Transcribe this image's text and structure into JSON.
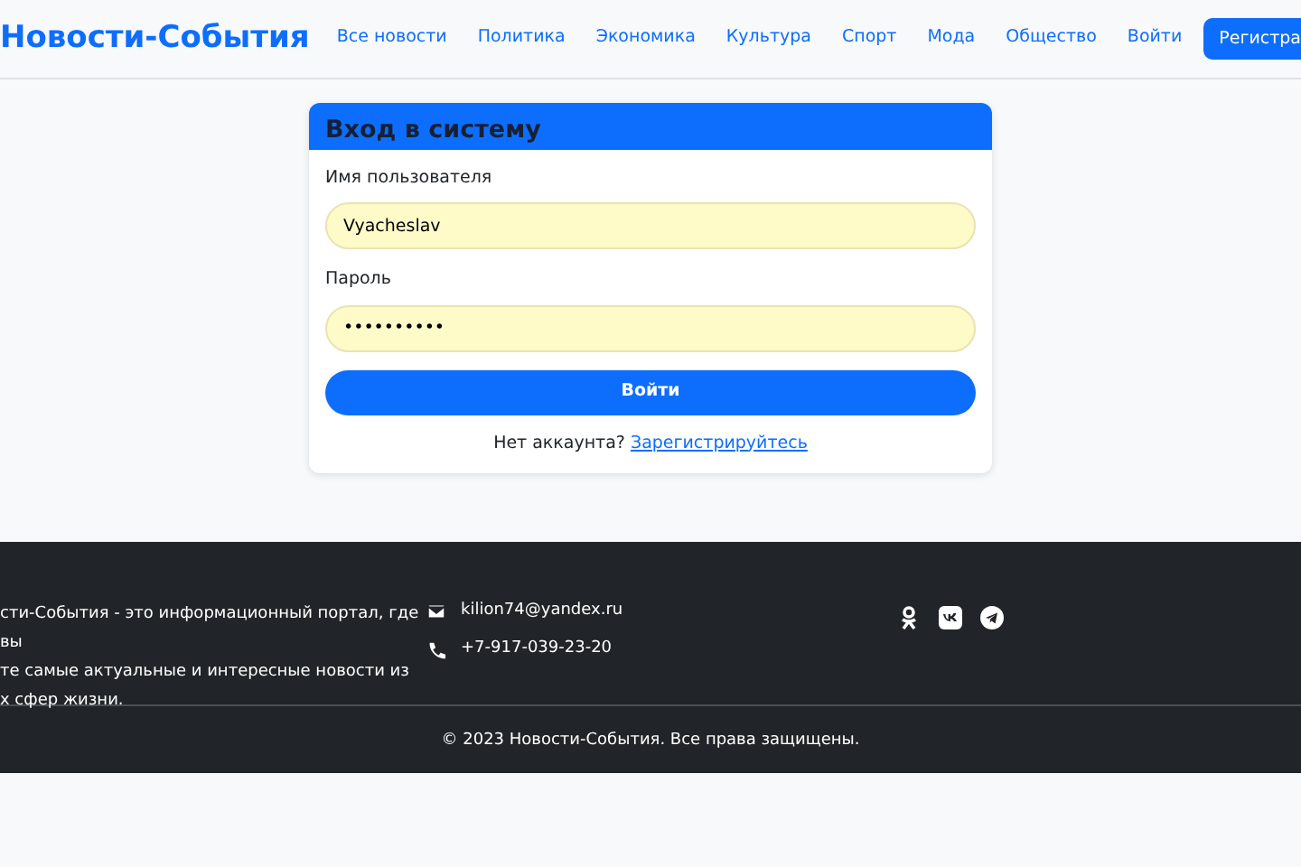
{
  "navbar": {
    "brand": "Новости-События",
    "links": [
      {
        "label": "Все новости"
      },
      {
        "label": "Политика"
      },
      {
        "label": "Экономика"
      },
      {
        "label": "Культура"
      },
      {
        "label": "Спорт"
      },
      {
        "label": "Мода"
      },
      {
        "label": "Общество"
      },
      {
        "label": "Войти"
      }
    ],
    "register_button": "Регистра"
  },
  "login": {
    "title": "Вход в систему",
    "fields": [
      {
        "label": "Имя пользователя",
        "value": "Vyacheslav"
      },
      {
        "label": "Пароль",
        "value": "••••••••••"
      }
    ],
    "submit": "Войти",
    "prompt": "Нет аккаунта?",
    "register_link": "Зарегистрируйтесь"
  },
  "footer": {
    "description_lines": [
      "сти-События - это информационный портал, где вы",
      "те самые актуальные и интересные новости из",
      "х сфер жизни."
    ],
    "contacts": [
      {
        "kind": "email",
        "text": "kilion74@yandex.ru"
      },
      {
        "kind": "phone",
        "text": "+7-917-039-23-20"
      }
    ],
    "social": [
      {
        "kind": "ok"
      },
      {
        "kind": "vk"
      },
      {
        "kind": "telegram"
      }
    ],
    "copyright": "© 2023 Новости-События. Все права защищены."
  }
}
